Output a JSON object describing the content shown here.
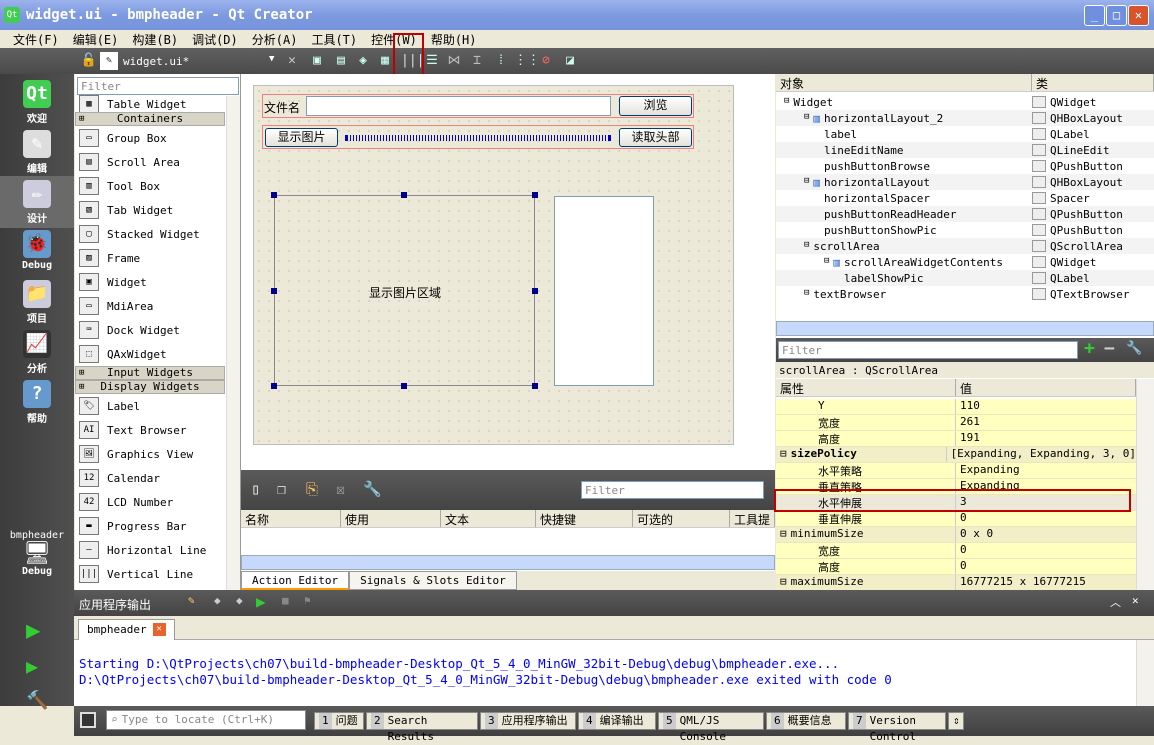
{
  "window": {
    "title": "widget.ui - bmpheader - Qt Creator"
  },
  "menu": [
    "文件(F)",
    "编辑(E)",
    "构建(B)",
    "调试(D)",
    "分析(A)",
    "工具(T)",
    "控件(W)",
    "帮助(H)"
  ],
  "toolbar": {
    "file": "widget.ui*"
  },
  "modes": [
    "欢迎",
    "编辑",
    "设计",
    "Debug",
    "项目",
    "分析",
    "帮助"
  ],
  "kit": {
    "project": "bmpheader",
    "mode": "Debug"
  },
  "widgetbox": {
    "filter_placeholder": "Filter",
    "items": [
      {
        "label": "Table Widget"
      },
      {
        "cat": "Containers"
      },
      {
        "label": "Group Box"
      },
      {
        "label": "Scroll Area"
      },
      {
        "label": "Tool Box"
      },
      {
        "label": "Tab Widget"
      },
      {
        "label": "Stacked Widget"
      },
      {
        "label": "Frame"
      },
      {
        "label": "Widget"
      },
      {
        "label": "MdiArea"
      },
      {
        "label": "Dock Widget"
      },
      {
        "label": "QAxWidget"
      },
      {
        "cat": "Input Widgets"
      },
      {
        "cat": "Display Widgets"
      },
      {
        "label": "Label"
      },
      {
        "label": "Text Browser"
      },
      {
        "label": "Graphics View"
      },
      {
        "label": "Calendar"
      },
      {
        "label": "LCD Number"
      },
      {
        "label": "Progress Bar"
      },
      {
        "label": "Horizontal Line"
      },
      {
        "label": "Vertical Line"
      }
    ]
  },
  "form": {
    "file_label": "文件名",
    "browse": "浏览",
    "show_pic": "显示图片",
    "read_header": "读取头部",
    "image_area": "显示图片区域"
  },
  "action_editor": {
    "filter_placeholder": "Filter",
    "columns": [
      "名称",
      "使用",
      "文本",
      "快捷键",
      "可选的",
      "工具提"
    ],
    "tabs": [
      "Action Editor",
      "Signals & Slots Editor"
    ]
  },
  "object_inspector": {
    "columns": [
      "对象",
      "类"
    ],
    "rows": [
      {
        "name": "Widget",
        "cls": "QWidget",
        "depth": 0
      },
      {
        "name": "horizontalLayout_2",
        "cls": "QHBoxLayout",
        "depth": 1
      },
      {
        "name": "label",
        "cls": "QLabel",
        "depth": 2
      },
      {
        "name": "lineEditName",
        "cls": "QLineEdit",
        "depth": 2
      },
      {
        "name": "pushButtonBrowse",
        "cls": "QPushButton",
        "depth": 2
      },
      {
        "name": "horizontalLayout",
        "cls": "QHBoxLayout",
        "depth": 1
      },
      {
        "name": "horizontalSpacer",
        "cls": "Spacer",
        "depth": 2
      },
      {
        "name": "pushButtonReadHeader",
        "cls": "QPushButton",
        "depth": 2
      },
      {
        "name": "pushButtonShowPic",
        "cls": "QPushButton",
        "depth": 2
      },
      {
        "name": "scrollArea",
        "cls": "QScrollArea",
        "depth": 1
      },
      {
        "name": "scrollAreaWidgetContents",
        "cls": "QWidget",
        "depth": 2
      },
      {
        "name": "labelShowPic",
        "cls": "QLabel",
        "depth": 3
      },
      {
        "name": "textBrowser",
        "cls": "QTextBrowser",
        "depth": 1
      }
    ]
  },
  "property_editor": {
    "filter_placeholder": "Filter",
    "object": "scrollArea : QScrollArea",
    "columns": [
      "属性",
      "值"
    ],
    "rows": [
      {
        "k": "Y",
        "v": "110"
      },
      {
        "k": "宽度",
        "v": "261"
      },
      {
        "k": "高度",
        "v": "191"
      },
      {
        "k": "sizePolicy",
        "v": "[Expanding, Expanding, 3, 0]",
        "group": true
      },
      {
        "k": "水平策略",
        "v": "Expanding"
      },
      {
        "k": "垂直策略",
        "v": "Expanding"
      },
      {
        "k": "水平伸展",
        "v": "3",
        "selected": true
      },
      {
        "k": "垂直伸展",
        "v": "0"
      },
      {
        "k": "minimumSize",
        "v": "0 x 0",
        "group": true
      },
      {
        "k": "宽度",
        "v": "0"
      },
      {
        "k": "高度",
        "v": "0"
      },
      {
        "k": "maximumSize",
        "v": "16777215 x 16777215",
        "group": true
      }
    ]
  },
  "output": {
    "title": "应用程序输出",
    "tab": "bmpheader",
    "lines": [
      "Starting D:\\QtProjects\\ch07\\build-bmpheader-Desktop_Qt_5_4_0_MinGW_32bit-Debug\\debug\\bmpheader.exe...",
      "D:\\QtProjects\\ch07\\build-bmpheader-Desktop_Qt_5_4_0_MinGW_32bit-Debug\\debug\\bmpheader.exe exited with code 0"
    ],
    "color": "#0000ff"
  },
  "statusbar": {
    "locate_placeholder": "Type to locate (Ctrl+K)",
    "tabs": [
      {
        "n": "1",
        "l": "问题"
      },
      {
        "n": "2",
        "l": "Search Results"
      },
      {
        "n": "3",
        "l": "应用程序输出"
      },
      {
        "n": "4",
        "l": "编译输出"
      },
      {
        "n": "5",
        "l": "QML/JS Console"
      },
      {
        "n": "6",
        "l": "概要信息"
      },
      {
        "n": "7",
        "l": "Version Control"
      }
    ]
  }
}
